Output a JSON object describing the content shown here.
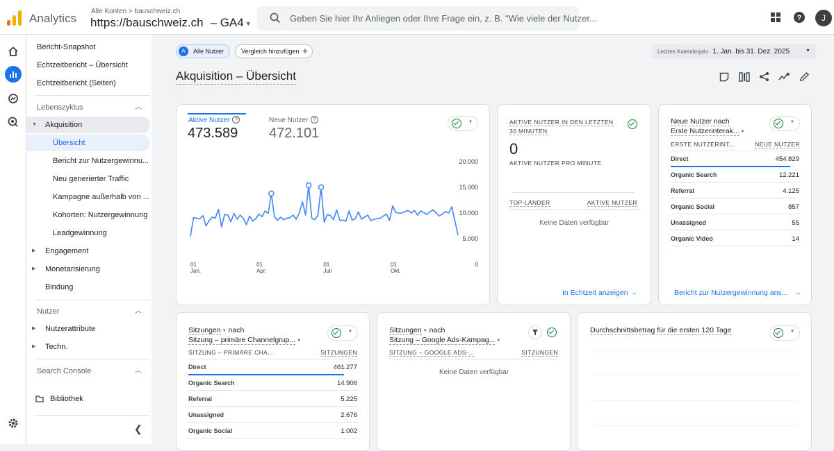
{
  "app": {
    "name": "Analytics",
    "breadcrumb": "Alle Konten > bauschweiz.ch",
    "property": "https://bauschweiz.ch",
    "property_suffix": "– GA4",
    "search_placeholder": "Geben Sie hier Ihr Anliegen oder Ihre Frage ein, z. B. \"Wie viele der Nutzer...",
    "avatar_letter": "J",
    "brand_colors": {
      "logo_orange": "#f9ab00",
      "logo_dark": "#e37400",
      "accent": "#1a73e8"
    }
  },
  "sidebar": {
    "items_top": [
      "Bericht-Snapshot",
      "Echtzeitbericht – Übersicht",
      "Echtzeitbericht (Seiten)"
    ],
    "lifecycle_section": "Lebenszyklus",
    "acquisition": "Akquisition",
    "acquisition_children": [
      "Übersicht",
      "Bericht zur Nutzergewinnu...",
      "Neu generierter Traffic",
      "Kampagne außerhalb von ...",
      "Kohorten: Nutzergewinnung",
      "Leadgewinnung"
    ],
    "engagement": "Engagement",
    "monetization": "Monetarisierung",
    "retention": "Bindung",
    "users_section": "Nutzer",
    "user_attributes": "Nutzerattribute",
    "tech": "Techn.",
    "search_console": "Search Console",
    "library": "Bibliothek"
  },
  "filters": {
    "segment_badge": "A",
    "segment": "Alle Nutzer",
    "compare": "Vergleich hinzufügen",
    "date_label": "Letztes Kalenderjahr",
    "date_value": "1. Jan. bis 31. Dez. 2025"
  },
  "page_title": "Akquisition – Übersicht",
  "card_users": {
    "active_label": "Aktive Nutzer",
    "active_value": "473.589",
    "new_label": "Neue Nutzer",
    "new_value": "472.101",
    "help_glyph": "?",
    "chart_data": {
      "type": "line",
      "title": "",
      "xlabel": "",
      "ylabel": "",
      "ylim": [
        0,
        20000
      ],
      "yticks": [
        "20.000",
        "15.000",
        "10.000",
        "5.000",
        "0"
      ],
      "xticks": [
        {
          "d": "01",
          "m": "Jan."
        },
        {
          "d": "01",
          "m": "Apr."
        },
        {
          "d": "01",
          "m": "Juli"
        },
        {
          "d": "01",
          "m": "Okt."
        }
      ],
      "color": "#4285f4",
      "series": [
        {
          "values": [
            5500,
            9100,
            9000,
            8900,
            9500,
            7500,
            8500,
            9200,
            9000,
            10700,
            7300,
            9700,
            9600,
            8300,
            9900,
            8800,
            9600,
            9000,
            7700,
            9400,
            8400,
            8900,
            9800,
            9300,
            10400,
            9900,
            13800,
            9300,
            8600,
            9200,
            8700,
            9000,
            9100,
            9600,
            8800,
            10000,
            12200,
            9600,
            15400,
            9000,
            8700,
            9600,
            15000,
            8200,
            9700,
            9500,
            8700,
            10600,
            8600,
            8600,
            8400,
            10400,
            8600,
            8900,
            10200,
            8800,
            9200,
            9600,
            8500,
            8800,
            8900,
            9000,
            9400,
            9800,
            8600,
            11400,
            10100,
            10000,
            10000,
            10300,
            10500,
            10000,
            10500,
            9600,
            10400,
            10100,
            9700,
            10300,
            10600,
            10000,
            9400,
            9800,
            10300,
            10000,
            11200,
            8500,
            5700
          ]
        }
      ],
      "markers": [
        26,
        38,
        42
      ]
    },
    "check_dropdown": "▾"
  },
  "card_realtime": {
    "title_line1": "AKTIVE NUTZER IN DEN LETZTEN",
    "title_line2": "30 MINUTEN",
    "value": "0",
    "per_minute_label": "AKTIVE NUTZER PRO MINUTE",
    "col_country": "TOP-LÄNDER",
    "col_users": "AKTIVE NUTZER",
    "no_data": "Keine Daten verfügbar",
    "link": "In Echtzeit anzeigen",
    "link_arrow": "→"
  },
  "card_new_users": {
    "title_line1": "Neue Nutzer nach",
    "title_line2": "Erste Nutzerinterak...",
    "col_dim": "ERSTE NUTZERINT...",
    "col_metric": "NEUE NUTZER",
    "rows": [
      {
        "label": "Direct",
        "value": "454.829"
      },
      {
        "label": "Organic Search",
        "value": "12.221"
      },
      {
        "label": "Referral",
        "value": "4.125"
      },
      {
        "label": "Organic Social",
        "value": "857"
      },
      {
        "label": "Unassigned",
        "value": "55"
      },
      {
        "label": "Organic Video",
        "value": "14"
      }
    ],
    "link": "Bericht zur Nutzergewinnung ans...",
    "link_arrow": "→"
  },
  "card_sessions_channel": {
    "title_line1": "Sitzungen",
    "title_nach": "nach",
    "title_line2": "Sitzung – primäre Channelgrup...",
    "col_dim": "SITZUNG – PRIMÄRE CHA...",
    "col_metric": "SITZUNGEN",
    "rows": [
      {
        "label": "Direct",
        "value": "461.277"
      },
      {
        "label": "Organic Search",
        "value": "14.906"
      },
      {
        "label": "Referral",
        "value": "5.225"
      },
      {
        "label": "Unassigned",
        "value": "2.676"
      },
      {
        "label": "Organic Social",
        "value": "1.002"
      }
    ]
  },
  "card_sessions_ads": {
    "title_line1": "Sitzungen",
    "title_nach": "nach",
    "title_line2": "Sitzung – Google Ads-Kampag...",
    "col_dim": "SITZUNG – GOOGLE ADS-...",
    "col_metric": "SITZUNGEN",
    "no_data": "Keine Daten verfügbar"
  },
  "card_avg_revenue": {
    "title": "Durchschnittsbetrag für die ersten 120 Tage"
  }
}
